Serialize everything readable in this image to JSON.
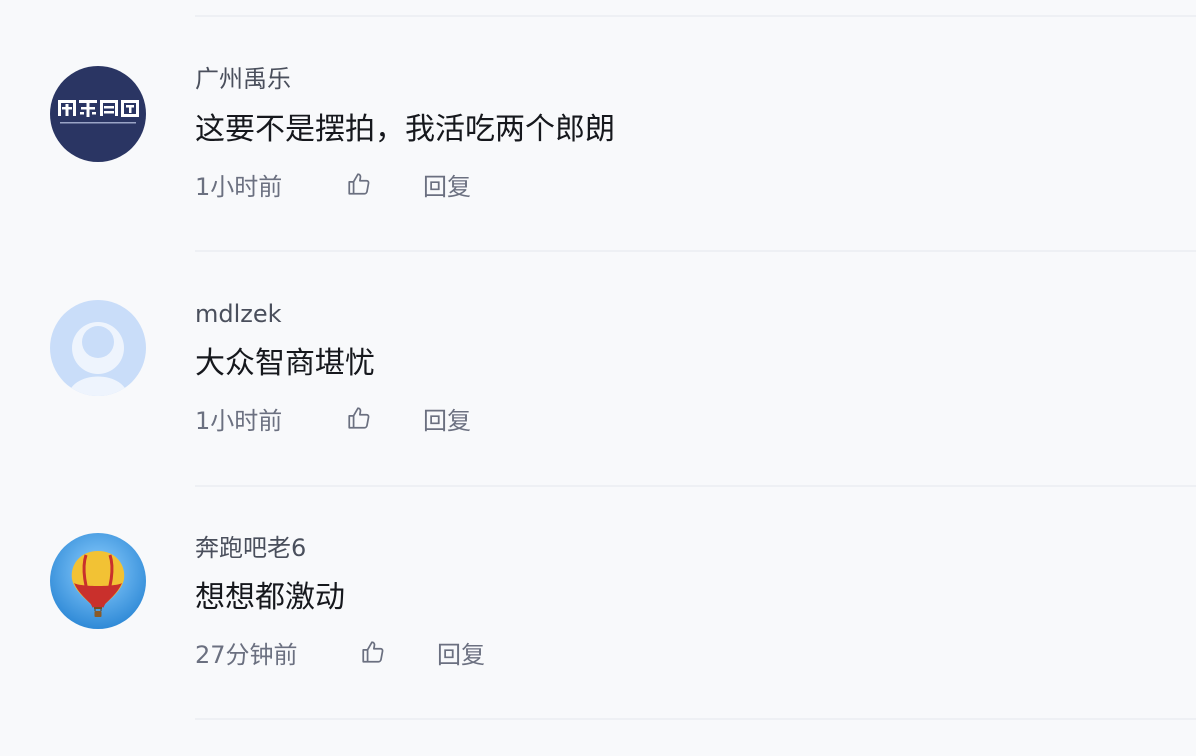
{
  "comments": [
    {
      "username": "广州禹乐",
      "content": "这要不是摆拍，我活吃两个郎朗",
      "time": "1小时前",
      "reply_label": "回复",
      "avatar": {
        "type": "logo",
        "text": "禹乐集团",
        "bg": "#2a3563",
        "fg": "#ffffff"
      }
    },
    {
      "username": "mdlzek",
      "content": "大众智商堪忧",
      "time": "1小时前",
      "reply_label": "回复",
      "avatar": {
        "type": "default-user-icon",
        "bg": "#c9ddf9",
        "fg": "#eef4fd"
      }
    },
    {
      "username": "奔跑吧老6",
      "content": "想想都激动",
      "time": "27分钟前",
      "reply_label": "回复",
      "avatar": {
        "type": "hot-air-balloon-icon",
        "bg": "#2f8fd8"
      }
    }
  ],
  "icons": {
    "like": "thumbs-up-icon"
  },
  "colors": {
    "background": "#f8f9fb",
    "divider": "#eef0f4",
    "username": "#4a4f5c",
    "content": "#16181d",
    "meta": "#6b7080"
  }
}
